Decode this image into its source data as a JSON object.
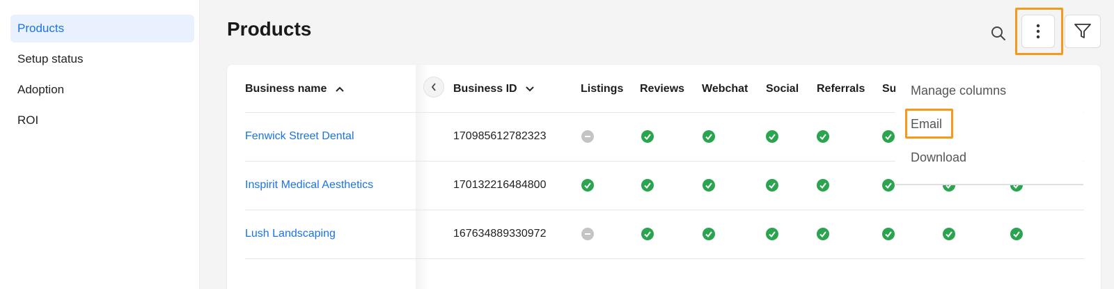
{
  "sidebar": {
    "items": [
      {
        "label": "Products",
        "active": true
      },
      {
        "label": "Setup status",
        "active": false
      },
      {
        "label": "Adoption",
        "active": false
      },
      {
        "label": "ROI",
        "active": false
      }
    ]
  },
  "header": {
    "title": "Products",
    "icons": {
      "search": "search-icon",
      "more": "more-vertical-icon",
      "filter": "filter-icon"
    }
  },
  "table": {
    "columns": [
      "Business name",
      "Business ID",
      "Listings",
      "Reviews",
      "Webchat",
      "Social",
      "Referrals",
      "Su"
    ],
    "sort": {
      "business_name": "ascending",
      "business_id": "descending"
    },
    "rows": [
      {
        "name": "Fenwick Street Dental",
        "id": "170985612782323",
        "listings": "inactive",
        "reviews": "active",
        "webchat": "active",
        "social": "active",
        "referrals": "active",
        "su": "active"
      },
      {
        "name": "Inspirit Medical Aesthetics",
        "id": "170132216484800",
        "listings": "active",
        "reviews": "active",
        "webchat": "active",
        "social": "active",
        "referrals": "active",
        "su": "active",
        "col9": "active",
        "col10": "active"
      },
      {
        "name": "Lush Landscaping",
        "id": "167634889330972",
        "listings": "inactive",
        "reviews": "active",
        "webchat": "active",
        "social": "active",
        "referrals": "active",
        "su": "active",
        "col9": "active",
        "col10": "active"
      }
    ]
  },
  "menu": {
    "items": [
      "Manage columns",
      "Email",
      "Download"
    ],
    "highlighted": "Email"
  },
  "colors": {
    "accent": "#1a73e8",
    "success": "#2aa44f",
    "inactive": "#c4c4c4",
    "highlight": "#f39a1e"
  }
}
